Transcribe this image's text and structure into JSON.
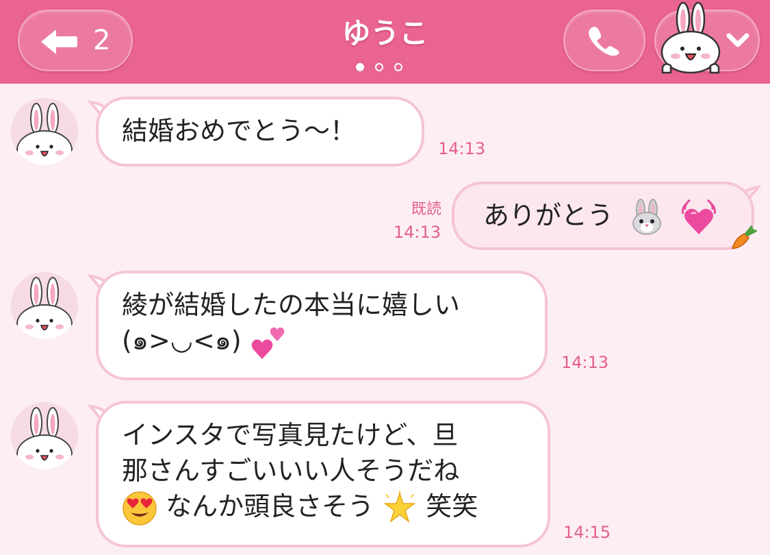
{
  "header": {
    "back_count": "2",
    "title": "ゆうこ",
    "pages": 3,
    "active_page": 0
  },
  "messages": [
    {
      "direction": "incoming",
      "text": "結婚おめでとう〜！",
      "time": "14:13"
    },
    {
      "direction": "outgoing",
      "text": "ありがとう",
      "read": "既読",
      "time": "14:13"
    },
    {
      "direction": "incoming",
      "line1": "綾が結婚したの本当に嬉しい",
      "line2": "(๑>◡<๑)",
      "time": "14:13"
    },
    {
      "direction": "incoming",
      "line1": "インスタで写真見たけど、旦",
      "line2": "那さんすごいいい人そうだね",
      "line3a": "なんか頭良さそう",
      "line3b": "笑笑",
      "time": "14:15"
    }
  ],
  "colors": {
    "header": "#e9648f",
    "background": "#fdeef3",
    "accent": "#e35f8d",
    "bubble_border": "#f5c4d5"
  }
}
